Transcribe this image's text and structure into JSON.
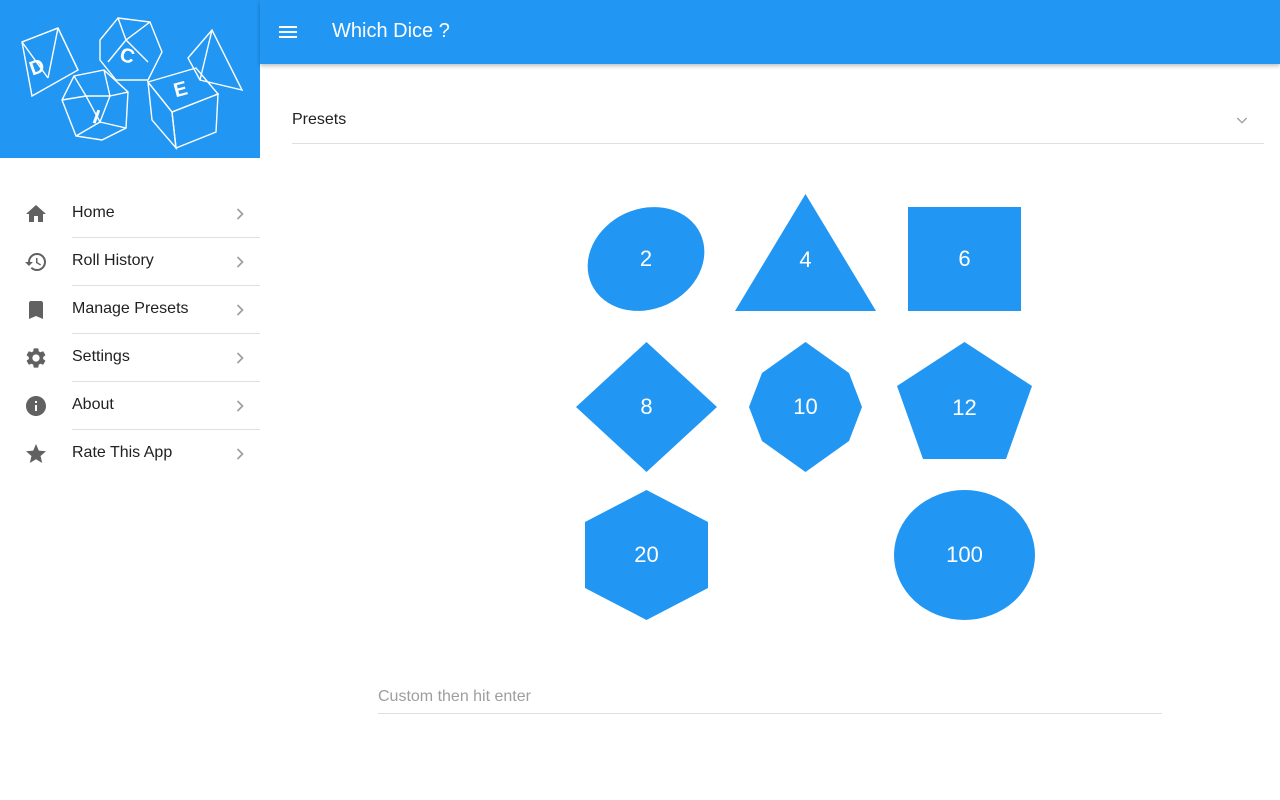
{
  "app": {
    "title": "Which Dice ?"
  },
  "logo": {
    "letters": [
      "D",
      "I",
      "C",
      "E"
    ]
  },
  "sidebar": {
    "items": [
      {
        "label": "Home",
        "icon": "home-icon"
      },
      {
        "label": "Roll History",
        "icon": "history-icon"
      },
      {
        "label": "Manage Presets",
        "icon": "bookmark-icon"
      },
      {
        "label": "Settings",
        "icon": "gear-icon"
      },
      {
        "label": "About",
        "icon": "info-icon"
      },
      {
        "label": "Rate This App",
        "icon": "star-icon"
      }
    ]
  },
  "presets": {
    "label": "Presets"
  },
  "dice": [
    {
      "value": "2",
      "shape": "ellipse"
    },
    {
      "value": "4",
      "shape": "triangle"
    },
    {
      "value": "6",
      "shape": "square"
    },
    {
      "value": "8",
      "shape": "diamond"
    },
    {
      "value": "10",
      "shape": "heptagon"
    },
    {
      "value": "12",
      "shape": "pentagon"
    },
    {
      "value": "20",
      "shape": "hexagon"
    },
    {
      "value": "100",
      "shape": "circle"
    }
  ],
  "custom": {
    "placeholder": "Custom then hit enter",
    "value": ""
  },
  "colors": {
    "primary": "#2196f3",
    "icon": "#616161",
    "text": "#212121",
    "divider": "#e0e0e0"
  }
}
